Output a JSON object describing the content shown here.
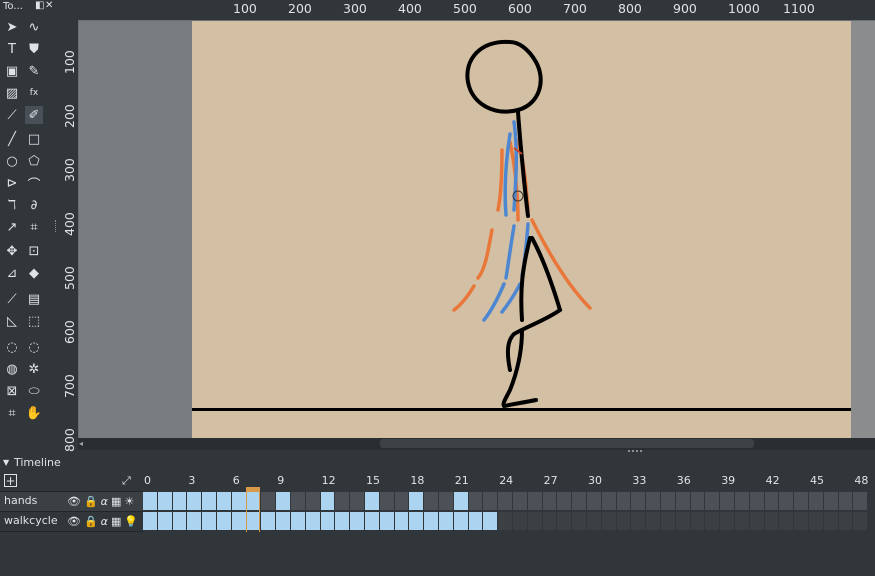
{
  "toolbox": {
    "title": "To...",
    "tools": [
      "select-icon",
      "lasso-icon",
      "text-icon",
      "stamp-icon",
      "image-icon",
      "pencil-edit-icon",
      "pattern-icon",
      "fx-icon",
      "dropper-icon",
      "brush-icon",
      "line-icon",
      "rect-icon",
      "ellipse-icon",
      "polygon-icon",
      "polyline-icon",
      "bezier-icon",
      "curve-icon",
      "freehand-path-icon",
      "smart-pen-icon",
      "crop-icon",
      "move-icon",
      "transform-icon",
      "measure-icon",
      "fill-icon",
      "color-picker-icon",
      "gradient-icon",
      "assistant-icon",
      "rect-select-icon",
      "ellipse-select-icon",
      "freehand-select-icon",
      "contiguous-select-icon",
      "magic-wand-icon",
      "similar-select-icon",
      "bezier-select-icon",
      "crop2-icon",
      "pan-icon"
    ]
  },
  "ruler": {
    "top_labels": [
      "100",
      "200",
      "300",
      "400",
      "500",
      "600",
      "700",
      "800",
      "900",
      "1000",
      "1100"
    ],
    "left_labels": [
      "100",
      "200",
      "300",
      "400",
      "500",
      "600",
      "700",
      "800"
    ]
  },
  "timeline": {
    "title": "Timeline",
    "frame_numbers": [
      "0",
      "3",
      "6",
      "9",
      "12",
      "15",
      "18",
      "21",
      "24",
      "27",
      "30",
      "33",
      "36",
      "39",
      "42",
      "45",
      "48"
    ],
    "layers": [
      {
        "name": "hands"
      },
      {
        "name": "walkcycle"
      }
    ],
    "current_frame": 7
  },
  "colors": {
    "accent": "#d69a4a",
    "frame_filled": "#aad4ef",
    "frame_empty": "#4b5157",
    "stroke_orange": "#e9773a",
    "stroke_blue": "#4d87d1"
  }
}
